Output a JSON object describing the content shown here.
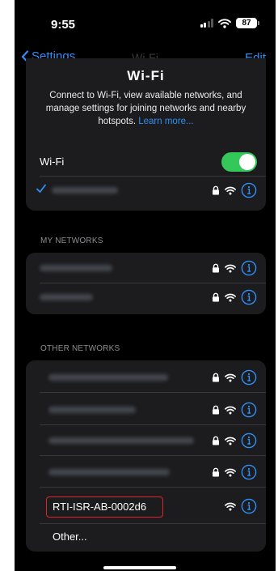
{
  "status_bar": {
    "time": "9:55",
    "battery": "87"
  },
  "nav": {
    "back_label": "Settings",
    "title": "Wi-Fi",
    "edit_label": "Edit"
  },
  "header": {
    "title": "Wi-Fi",
    "description": "Connect to Wi-Fi, view available networks, and manage settings for joining networks and nearby hotspots.",
    "learn_more": "Learn more..."
  },
  "wifi_toggle": {
    "label": "Wi-Fi",
    "on": true
  },
  "my_networks": {
    "header": "MY NETWORKS"
  },
  "other_networks": {
    "header": "OTHER NETWORKS",
    "visible_network": "RTI-ISR-AB-0002d6",
    "other_label": "Other..."
  },
  "colors": {
    "accent": "#2f8ff5",
    "toggle_on": "#34c759",
    "highlight": "#e0262b",
    "cell_bg": "#1c1c1e"
  },
  "icons": [
    "chevron-left-icon",
    "lock-icon",
    "wifi-icon",
    "info-icon",
    "checkmark-icon"
  ]
}
